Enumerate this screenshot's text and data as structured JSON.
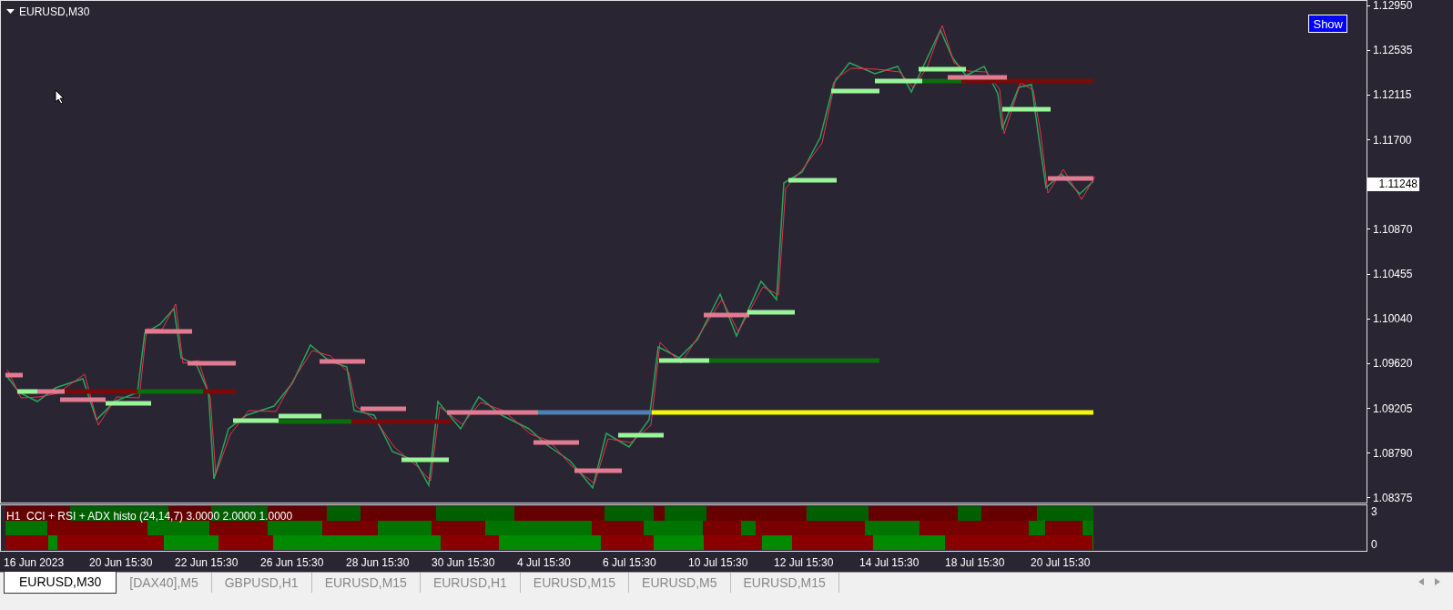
{
  "chart": {
    "title": "EURUSD,M30",
    "show_button": "Show"
  },
  "price_axis": {
    "labels": [
      {
        "kind": "tick",
        "text": "1.12950"
      },
      {
        "kind": "tick",
        "text": "1.12535"
      },
      {
        "kind": "tick",
        "text": "1.12115"
      },
      {
        "kind": "tick",
        "text": "1.11700"
      },
      {
        "kind": "current",
        "text": "1.11248"
      },
      {
        "kind": "tick",
        "text": "1.10870"
      },
      {
        "kind": "tick",
        "text": "1.10455"
      },
      {
        "kind": "tick",
        "text": "1.10040"
      },
      {
        "kind": "tick",
        "text": "1.09620"
      },
      {
        "kind": "tick",
        "text": "1.09205"
      },
      {
        "kind": "tick",
        "text": "1.08790"
      },
      {
        "kind": "tick",
        "text": "1.08375"
      }
    ]
  },
  "indicator": {
    "label": "H1  CCI + RSI + ADX histo (24,14,7) 3.0000 2.0000 1.0000",
    "axis": [
      "3",
      "0"
    ]
  },
  "time_axis": [
    "16 Jun 2023",
    "20 Jun 15:30",
    "22 Jun 15:30",
    "26 Jun 15:30",
    "28 Jun 15:30",
    "30 Jun 15:30",
    "4 Jul 15:30",
    "6 Jul 15:30",
    "10 Jul 15:30",
    "12 Jul 15:30",
    "14 Jul 15:30",
    "18 Jul 15:30",
    "20 Jul 15:30"
  ],
  "tabs": [
    {
      "label": "EURUSD,M30",
      "selected": true
    },
    {
      "label": "[DAX40],M5",
      "selected": false
    },
    {
      "label": "GBPUSD,H1",
      "selected": false
    },
    {
      "label": "EURUSD,M15",
      "selected": false
    },
    {
      "label": "EURUSD,H1",
      "selected": false
    },
    {
      "label": "EURUSD,M15",
      "selected": false
    },
    {
      "label": "EURUSD,M5",
      "selected": false
    },
    {
      "label": "EURUSD,M15",
      "selected": false
    }
  ]
}
